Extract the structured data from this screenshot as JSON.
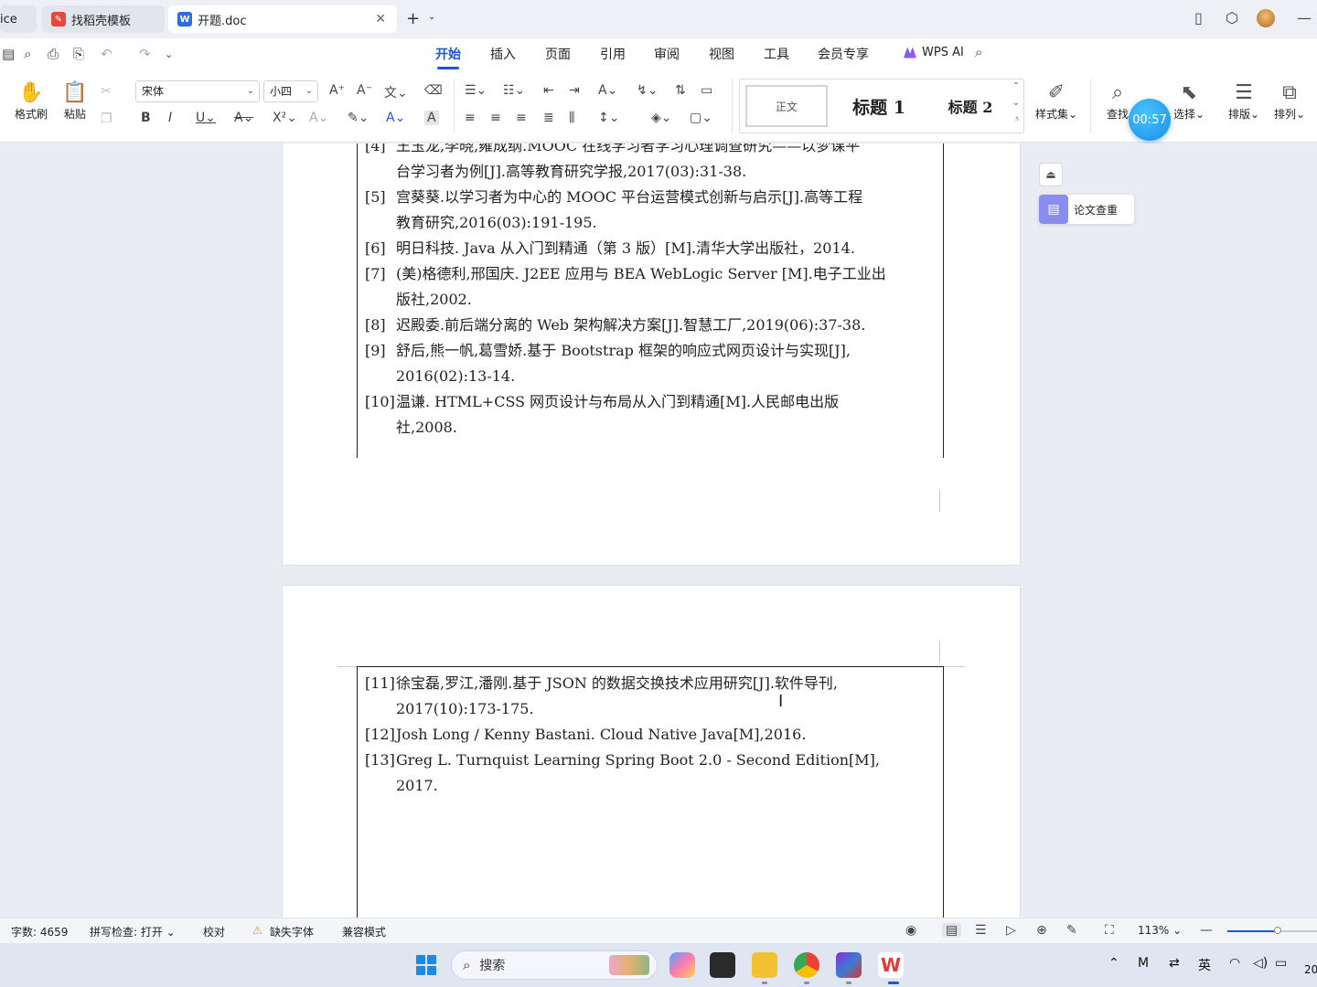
{
  "tabs": [
    {
      "label": "ice"
    },
    {
      "label": "找稻壳模板",
      "icon_color": "#e24a3b"
    },
    {
      "label": "开题.doc",
      "icon_color": "#2b6de8",
      "icon_letter": "W"
    }
  ],
  "menu": {
    "items": [
      "开始",
      "插入",
      "页面",
      "引用",
      "审阅",
      "视图",
      "工具",
      "会员专享"
    ],
    "active": "开始",
    "ai_label": "WPS AI"
  },
  "ribbon": {
    "format_painter": "格式刷",
    "paste": "粘贴",
    "font_name": "宋体",
    "font_size": "小四",
    "styles": {
      "normal": "正文",
      "h1": "标题 1",
      "h2": "标题 2"
    },
    "style_set": "样式集",
    "find": "查找",
    "select": "选择",
    "layout": "排版",
    "arrange": "排列",
    "timer": "00:57"
  },
  "side_panel": {
    "paper_check": "论文查重"
  },
  "references_page1": [
    {
      "num": "[4]",
      "lines": [
        "王玉龙,李晓,雍成纲.MOOC 在线学习者学习心理调查研究——以梦课平",
        "台学习者为例[J].高等教育研究学报,2017(03):31-38."
      ]
    },
    {
      "num": "[5]",
      "lines": [
        "宫葵葵.以学习者为中心的 MOOC 平台运营模式创新与启示[J].高等工程",
        "教育研究,2016(03):191-195."
      ]
    },
    {
      "num": "[6]",
      "lines": [
        "明日科技. Java 从入门到精通（第 3 版）[M].清华大学出版社，2014."
      ]
    },
    {
      "num": "[7]",
      "lines": [
        "(美)格德利,邢国庆. J2EE 应用与 BEA WebLogic Server [M].电子工业出",
        "版社,2002."
      ]
    },
    {
      "num": "[8]",
      "lines": [
        "迟殿委.前后端分离的 Web 架构解决方案[J].智慧工厂,2019(06):37-38."
      ]
    },
    {
      "num": "[9]",
      "lines": [
        "舒后,熊一帆,葛雪娇.基于 Bootstrap 框架的响应式网页设计与实现[J],",
        "2016(02):13-14."
      ]
    },
    {
      "num": "[10]",
      "lines": [
        "温谦. HTML+CSS 网页设计与布局从入门到精通[M].人民邮电出版",
        "社,2008."
      ]
    }
  ],
  "references_page2": [
    {
      "num": "[11]",
      "lines": [
        "徐宝磊,罗江,潘刚.基于 JSON 的数据交换技术应用研究[J].软件导刊,",
        "2017(10):173-175."
      ]
    },
    {
      "num": "[12]",
      "lines": [
        "Josh Long / Kenny Bastani. Cloud Native Java[M],2016."
      ]
    },
    {
      "num": "[13]",
      "lines": [
        "Greg L. Turnquist Learning Spring Boot 2.0 - Second Edition[M],",
        "2017."
      ]
    }
  ],
  "status": {
    "word_count": "字数: 4659",
    "spell_check": "拼写检查: 打开",
    "proof": "校对",
    "missing_font": "缺失字体",
    "compat_mode": "兼容模式",
    "zoom": "113%",
    "zoom_fraction": 0.56
  },
  "taskbar": {
    "search_placeholder": "搜索",
    "ime": "英",
    "clock_partial": "20"
  }
}
